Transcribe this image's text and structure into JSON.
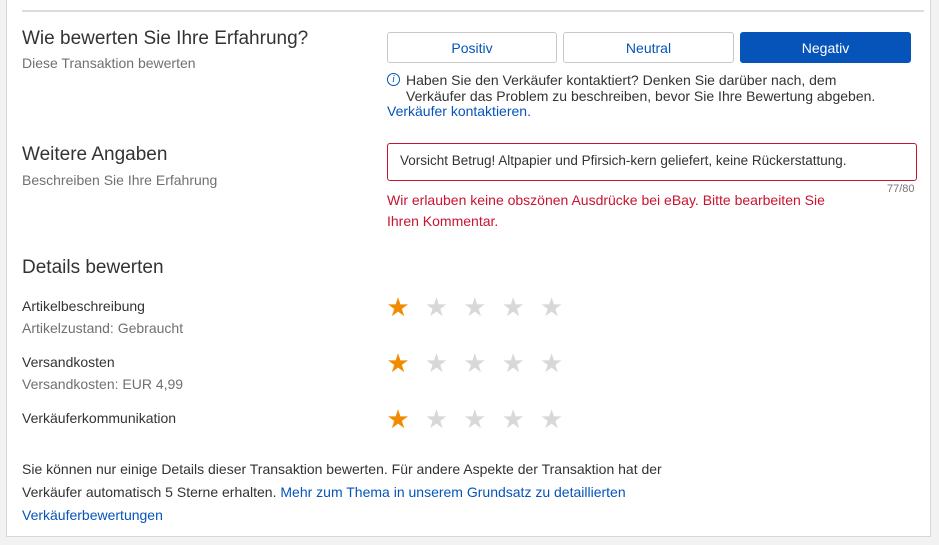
{
  "experience": {
    "title": "Wie bewerten Sie Ihre Erfahrung?",
    "subtitle": "Diese Transaktion bewerten",
    "buttons": {
      "positive": "Positiv",
      "neutral": "Neutral",
      "negative": "Negativ"
    },
    "selected": "Negativ"
  },
  "notice": {
    "line1": "Haben Sie den Verkäufer kontaktiert? Denken Sie darüber nach, dem",
    "line2": "Verkäufer das Problem zu beschreiben, bevor Sie Ihre Bewertung abgeben.",
    "link": "Verkäufer kontaktieren."
  },
  "details_section": {
    "title": "Weitere Angaben",
    "subtitle": "Beschreiben Sie Ihre Erfahrung",
    "comment": "Vorsicht Betrug! Altpapier und Pfirsich-kern geliefert, keine Rückerstattung.",
    "counter": "77/80",
    "error_line1": "Wir erlauben keine obszönen Ausdrücke bei eBay. Bitte bearbeiten Sie",
    "error_line2": "Ihren Kommentar."
  },
  "ratings": {
    "title": "Details bewerten",
    "max_stars": 5,
    "items": [
      {
        "label": "Artikelbeschreibung",
        "sublabel": "Artikelzustand: Gebraucht",
        "stars": 1
      },
      {
        "label": "Versandkosten",
        "sublabel": "Versandkosten: EUR 4,99",
        "stars": 1
      },
      {
        "label": "Verkäuferkommunikation",
        "sublabel": "",
        "stars": 1
      }
    ]
  },
  "footer": {
    "line1": "Sie können nur einige Details dieser Transaktion bewerten. Für andere Aspekte der Transaktion hat der",
    "line2_prefix": "Verkäufer automatisch 5 Sterne erhalten.",
    "link_part1": "Mehr zum Thema in unserem Grundsatz zu detaillierten",
    "link_part2": "Verkäuferbewertungen"
  },
  "colors": {
    "accent": "#0654ba",
    "error": "#c9132f",
    "star_on": "#f18c00",
    "star_off": "#d8d8d8"
  }
}
